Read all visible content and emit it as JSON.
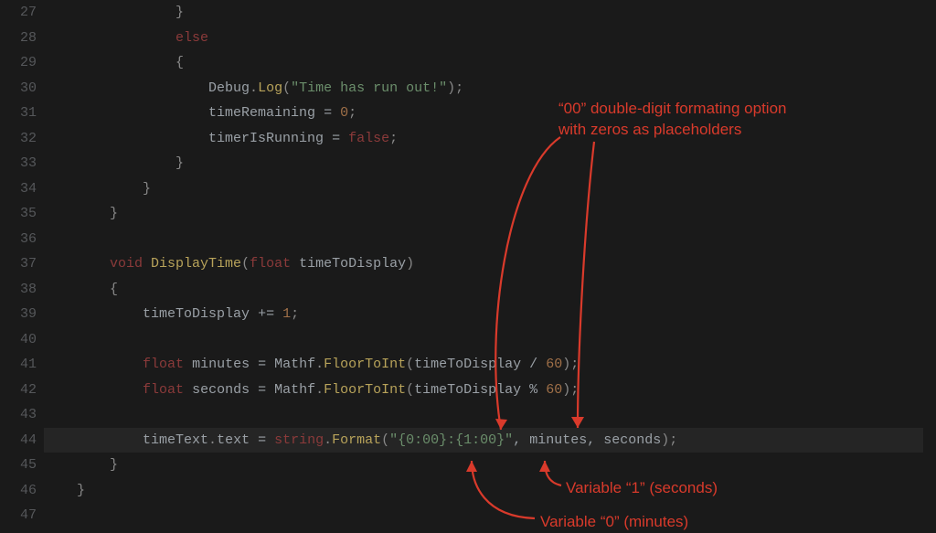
{
  "gutter": {
    "start": 27,
    "end": 47
  },
  "code": {
    "l27": {
      "brace": "}"
    },
    "l28": {
      "kw": "else"
    },
    "l29": {
      "brace": "{"
    },
    "l30": {
      "type": "Debug",
      "dot": ".",
      "fn": "Log",
      "op1": "(",
      "str": "\"Time has run out!\"",
      "op2": ");"
    },
    "l31": {
      "ident": "timeRemaining",
      "eq": " = ",
      "num": "0",
      "semi": ";"
    },
    "l32": {
      "ident": "timerIsRunning",
      "eq": " = ",
      "bool": "false",
      "semi": ";"
    },
    "l33": {
      "brace": "}"
    },
    "l34": {
      "brace": "}"
    },
    "l35": {
      "brace": "}"
    },
    "l37": {
      "kw1": "void",
      "sp1": " ",
      "fn": "DisplayTime",
      "op1": "(",
      "kw2": "float",
      "sp2": " ",
      "ident": "timeToDisplay",
      "op2": ")"
    },
    "l38": {
      "brace": "{"
    },
    "l39": {
      "ident": "timeToDisplay",
      "op": " += ",
      "num": "1",
      "semi": ";"
    },
    "l41": {
      "kw": "float",
      "sp": " ",
      "ident": "minutes",
      "eq": " = ",
      "type": "Mathf",
      "dot": ".",
      "fn": "FloorToInt",
      "op1": "(",
      "arg": "timeToDisplay / ",
      "num": "60",
      "op2": ");"
    },
    "l42": {
      "kw": "float",
      "sp": " ",
      "ident": "seconds",
      "eq": " = ",
      "type": "Mathf",
      "dot": ".",
      "fn": "FloorToInt",
      "op1": "(",
      "arg": "timeToDisplay % ",
      "num": "60",
      "op2": ");"
    },
    "l44": {
      "ident1": "timeText",
      "dot1": ".",
      "prop": "text",
      "eq": " = ",
      "kw": "string",
      "dot2": ".",
      "fn": "Format",
      "op1": "(",
      "str": "\"{0:00}:{1:00}\"",
      "c1": ", ",
      "arg1": "minutes",
      "c2": ", ",
      "arg2": "seconds",
      "op2": ");"
    },
    "l45": {
      "brace": "}"
    },
    "l46": {
      "brace": "}"
    }
  },
  "annotations": {
    "topline1": "“00” double-digit formating option",
    "topline2": "with zeros as placeholders",
    "var1": "Variable “1” (seconds)",
    "var0": "Variable “0” (minutes)"
  }
}
